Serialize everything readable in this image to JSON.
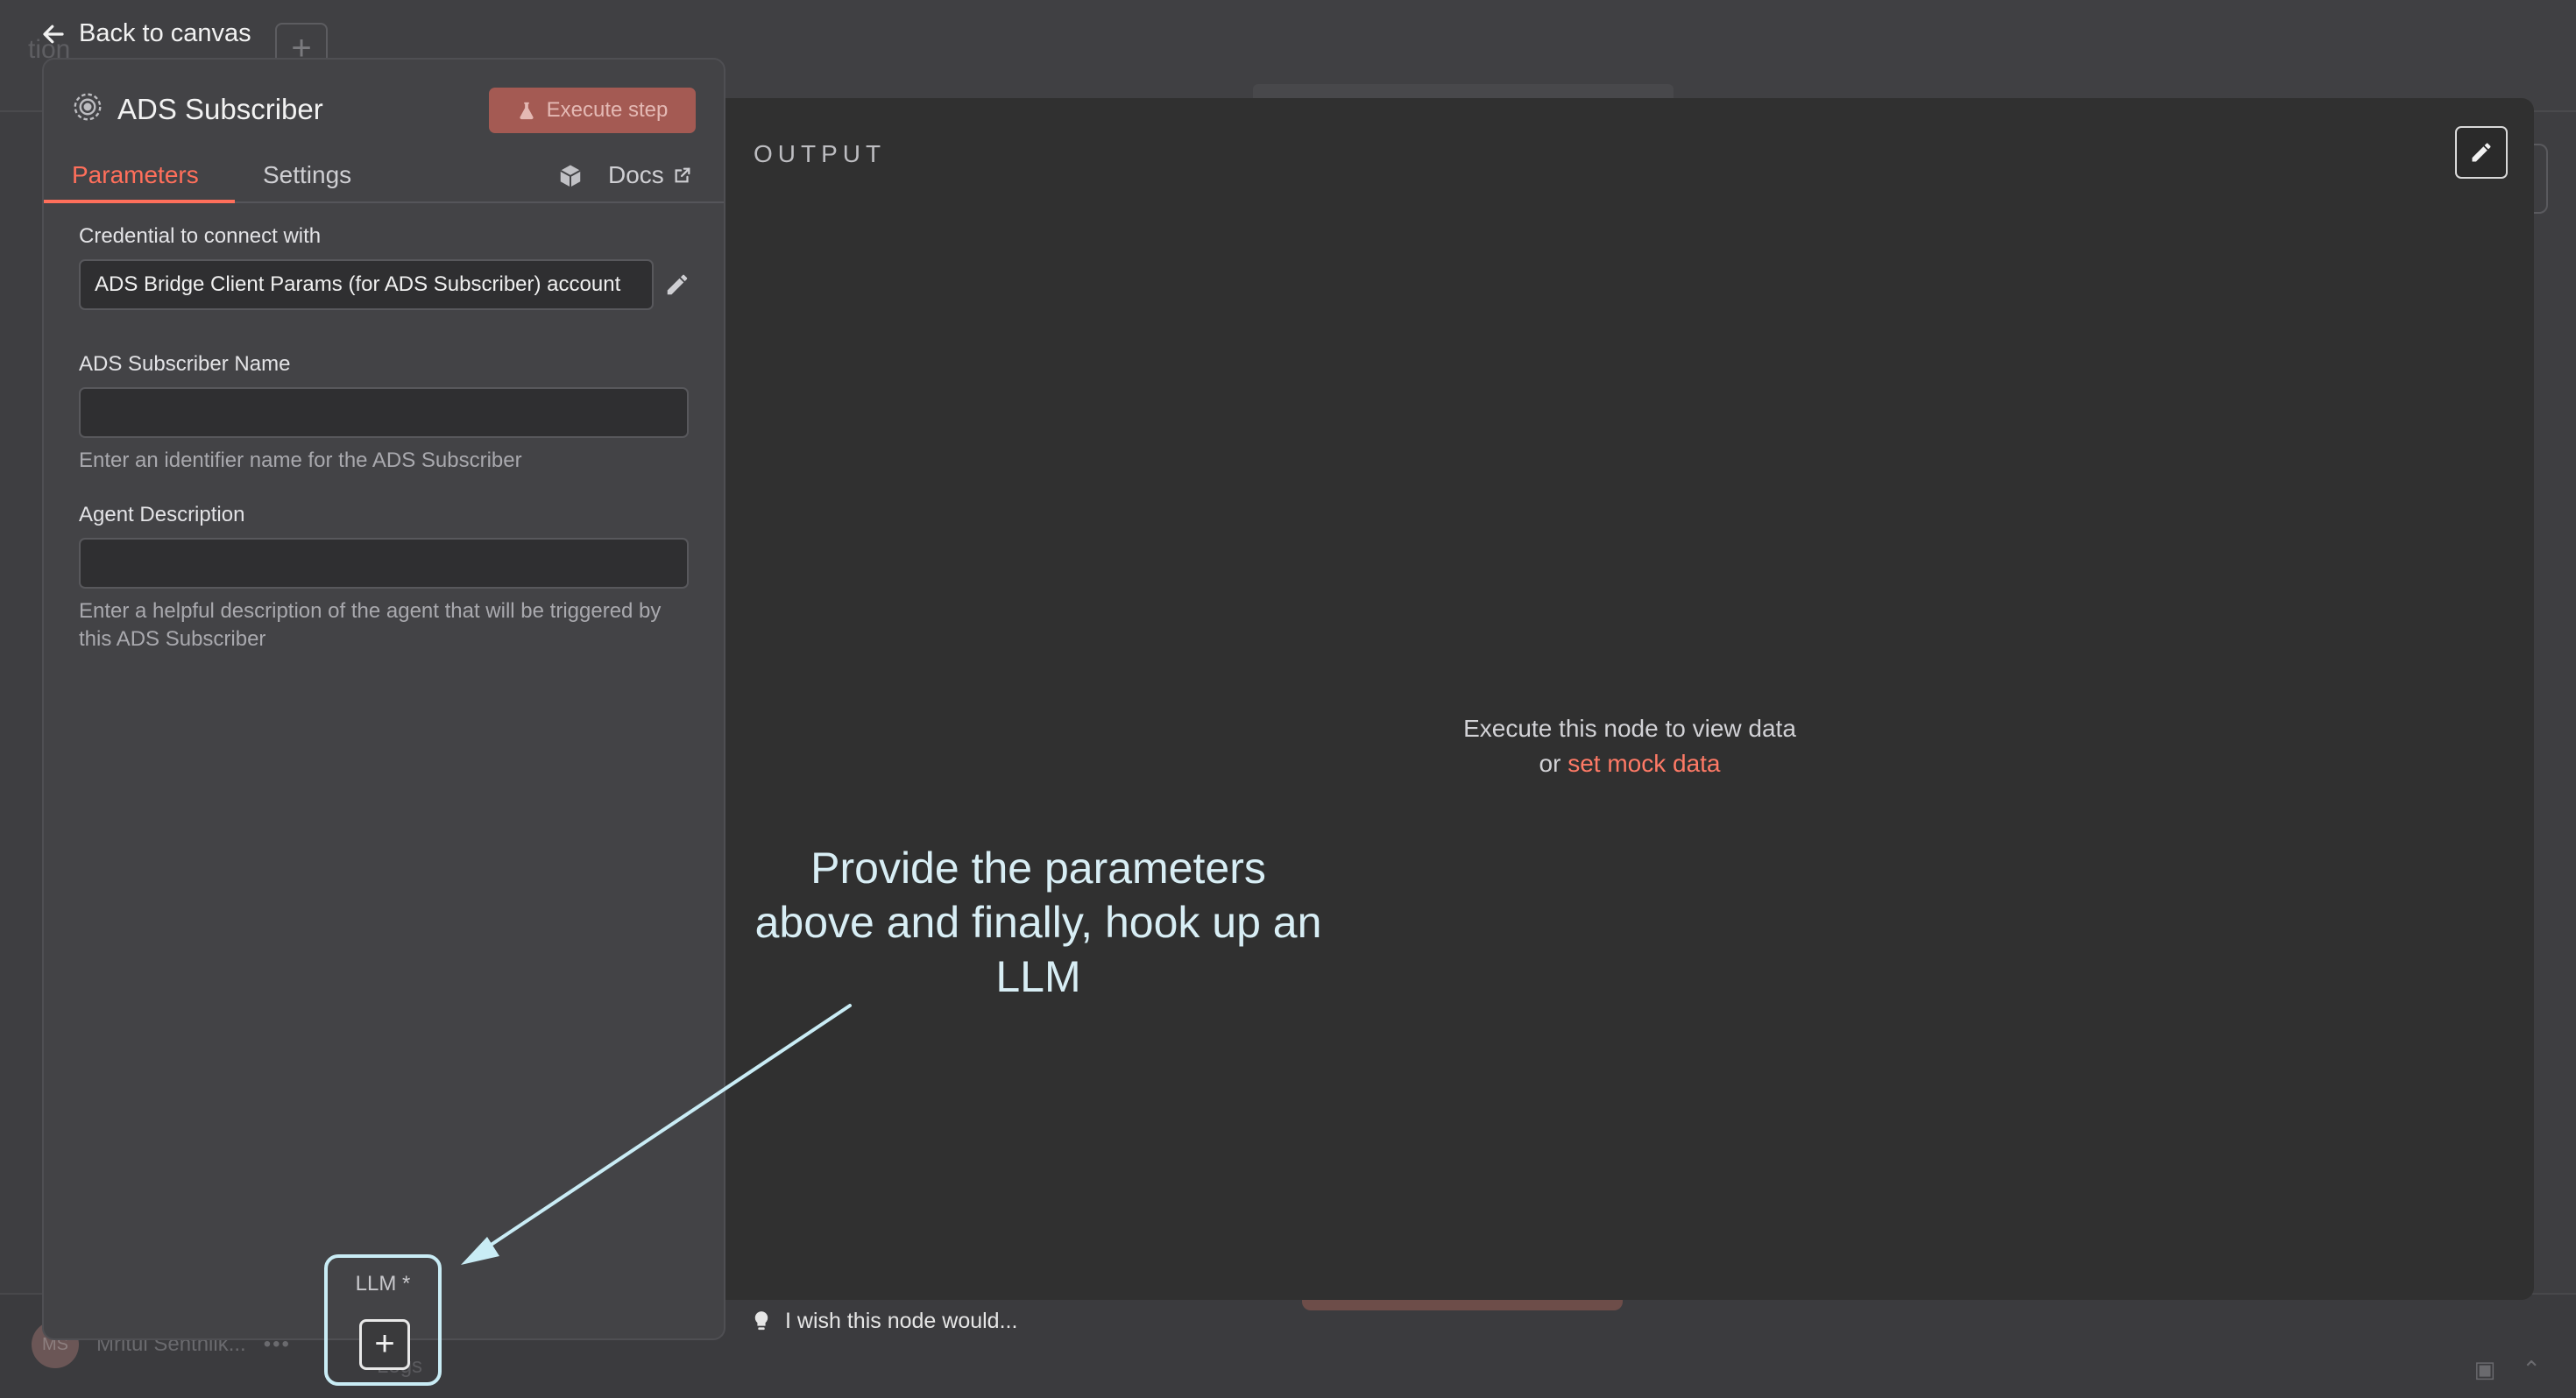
{
  "background": {
    "ghost_title": "tion",
    "user_name": "Mritul Senthilk...",
    "user_initials": "MS",
    "logs_label": "Logs"
  },
  "nav": {
    "back_label": "Back to canvas"
  },
  "panel": {
    "node_title": "ADS Subscriber",
    "execute_label": "Execute step",
    "tabs": [
      {
        "label": "Parameters",
        "active": true
      },
      {
        "label": "Settings",
        "active": false
      }
    ],
    "docs_label": "Docs",
    "fields": {
      "credential": {
        "label": "Credential to connect with",
        "value": "ADS Bridge Client Params (for ADS Subscriber) account"
      },
      "subscriber_name": {
        "label": "ADS Subscriber Name",
        "value": "",
        "hint": "Enter an identifier name for the ADS Subscriber"
      },
      "agent_description": {
        "label": "Agent Description",
        "value": "",
        "hint": "Enter a helpful description of the agent that will be triggered by this ADS Subscriber"
      }
    }
  },
  "output": {
    "label": "OUTPUT",
    "empty_line1": "Execute this node to view data",
    "empty_or": "or",
    "mock_link": "set mock data"
  },
  "annotation": {
    "text": "Provide the parameters above and finally, hook up an LLM"
  },
  "llm": {
    "label": "LLM *",
    "add_symbol": "+"
  },
  "feedback": {
    "text": "I wish this node would..."
  },
  "colors": {
    "accent": "#ff6f5b",
    "panel_bg": "#434346",
    "output_bg": "#303030",
    "annotation": "#c9ecf5"
  }
}
